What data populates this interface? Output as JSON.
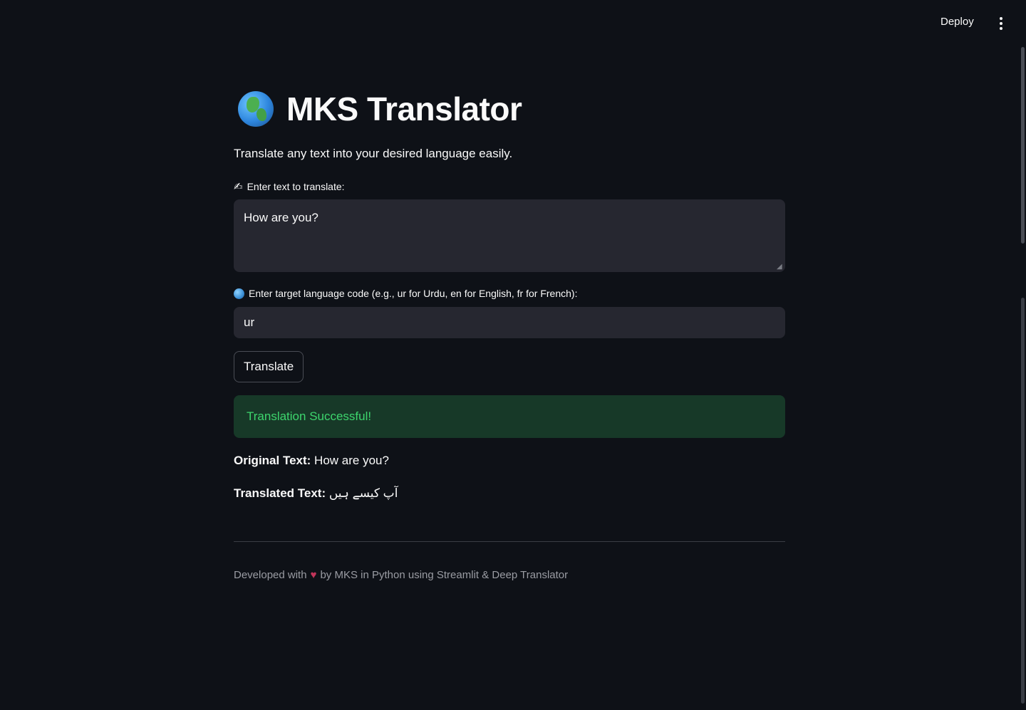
{
  "toolbar": {
    "deploy_label": "Deploy",
    "menu_icon": "kebab-menu-icon"
  },
  "header": {
    "title": "MKS Translator",
    "title_icon": "globe-icon",
    "subtitle": "Translate any text into your desired language easily."
  },
  "form": {
    "text_label_icon": "✍",
    "text_label": "Enter text to translate:",
    "text_value": "How are you?",
    "lang_label_icon": "globe-icon",
    "lang_label": "Enter target language code (e.g., ur for Urdu, en for English, fr for French):",
    "lang_value": "ur",
    "translate_label": "Translate"
  },
  "result": {
    "success_message": "Translation Successful!",
    "original_label": "Original Text:",
    "original_value": "How are you?",
    "translated_label": "Translated Text:",
    "translated_value": "آپ کیسے ہیں"
  },
  "footer": {
    "prefix": "Developed with",
    "heart": "♥",
    "suffix": "by MKS in Python using Streamlit & Deep Translator"
  },
  "colors": {
    "background": "#0e1117",
    "input_bg": "#262730",
    "success_bg": "#173928",
    "success_text": "#3dd56d"
  }
}
